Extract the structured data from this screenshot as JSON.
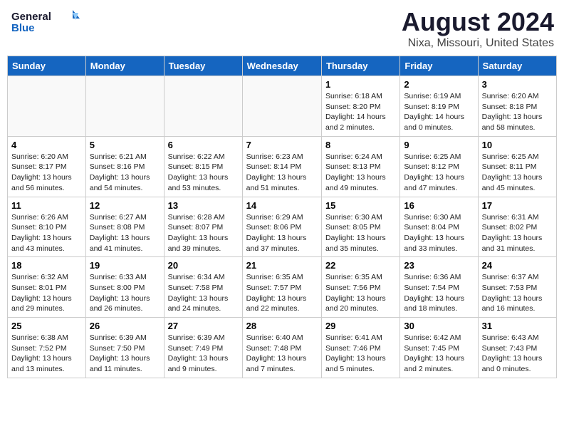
{
  "logo": {
    "line1": "General",
    "line2": "Blue",
    "tagline": ""
  },
  "title": "August 2024",
  "subtitle": "Nixa, Missouri, United States",
  "days_of_week": [
    "Sunday",
    "Monday",
    "Tuesday",
    "Wednesday",
    "Thursday",
    "Friday",
    "Saturday"
  ],
  "weeks": [
    [
      {
        "day": "",
        "info": ""
      },
      {
        "day": "",
        "info": ""
      },
      {
        "day": "",
        "info": ""
      },
      {
        "day": "",
        "info": ""
      },
      {
        "day": "1",
        "info": "Sunrise: 6:18 AM\nSunset: 8:20 PM\nDaylight: 14 hours\nand 2 minutes."
      },
      {
        "day": "2",
        "info": "Sunrise: 6:19 AM\nSunset: 8:19 PM\nDaylight: 14 hours\nand 0 minutes."
      },
      {
        "day": "3",
        "info": "Sunrise: 6:20 AM\nSunset: 8:18 PM\nDaylight: 13 hours\nand 58 minutes."
      }
    ],
    [
      {
        "day": "4",
        "info": "Sunrise: 6:20 AM\nSunset: 8:17 PM\nDaylight: 13 hours\nand 56 minutes."
      },
      {
        "day": "5",
        "info": "Sunrise: 6:21 AM\nSunset: 8:16 PM\nDaylight: 13 hours\nand 54 minutes."
      },
      {
        "day": "6",
        "info": "Sunrise: 6:22 AM\nSunset: 8:15 PM\nDaylight: 13 hours\nand 53 minutes."
      },
      {
        "day": "7",
        "info": "Sunrise: 6:23 AM\nSunset: 8:14 PM\nDaylight: 13 hours\nand 51 minutes."
      },
      {
        "day": "8",
        "info": "Sunrise: 6:24 AM\nSunset: 8:13 PM\nDaylight: 13 hours\nand 49 minutes."
      },
      {
        "day": "9",
        "info": "Sunrise: 6:25 AM\nSunset: 8:12 PM\nDaylight: 13 hours\nand 47 minutes."
      },
      {
        "day": "10",
        "info": "Sunrise: 6:25 AM\nSunset: 8:11 PM\nDaylight: 13 hours\nand 45 minutes."
      }
    ],
    [
      {
        "day": "11",
        "info": "Sunrise: 6:26 AM\nSunset: 8:10 PM\nDaylight: 13 hours\nand 43 minutes."
      },
      {
        "day": "12",
        "info": "Sunrise: 6:27 AM\nSunset: 8:08 PM\nDaylight: 13 hours\nand 41 minutes."
      },
      {
        "day": "13",
        "info": "Sunrise: 6:28 AM\nSunset: 8:07 PM\nDaylight: 13 hours\nand 39 minutes."
      },
      {
        "day": "14",
        "info": "Sunrise: 6:29 AM\nSunset: 8:06 PM\nDaylight: 13 hours\nand 37 minutes."
      },
      {
        "day": "15",
        "info": "Sunrise: 6:30 AM\nSunset: 8:05 PM\nDaylight: 13 hours\nand 35 minutes."
      },
      {
        "day": "16",
        "info": "Sunrise: 6:30 AM\nSunset: 8:04 PM\nDaylight: 13 hours\nand 33 minutes."
      },
      {
        "day": "17",
        "info": "Sunrise: 6:31 AM\nSunset: 8:02 PM\nDaylight: 13 hours\nand 31 minutes."
      }
    ],
    [
      {
        "day": "18",
        "info": "Sunrise: 6:32 AM\nSunset: 8:01 PM\nDaylight: 13 hours\nand 29 minutes."
      },
      {
        "day": "19",
        "info": "Sunrise: 6:33 AM\nSunset: 8:00 PM\nDaylight: 13 hours\nand 26 minutes."
      },
      {
        "day": "20",
        "info": "Sunrise: 6:34 AM\nSunset: 7:58 PM\nDaylight: 13 hours\nand 24 minutes."
      },
      {
        "day": "21",
        "info": "Sunrise: 6:35 AM\nSunset: 7:57 PM\nDaylight: 13 hours\nand 22 minutes."
      },
      {
        "day": "22",
        "info": "Sunrise: 6:35 AM\nSunset: 7:56 PM\nDaylight: 13 hours\nand 20 minutes."
      },
      {
        "day": "23",
        "info": "Sunrise: 6:36 AM\nSunset: 7:54 PM\nDaylight: 13 hours\nand 18 minutes."
      },
      {
        "day": "24",
        "info": "Sunrise: 6:37 AM\nSunset: 7:53 PM\nDaylight: 13 hours\nand 16 minutes."
      }
    ],
    [
      {
        "day": "25",
        "info": "Sunrise: 6:38 AM\nSunset: 7:52 PM\nDaylight: 13 hours\nand 13 minutes."
      },
      {
        "day": "26",
        "info": "Sunrise: 6:39 AM\nSunset: 7:50 PM\nDaylight: 13 hours\nand 11 minutes."
      },
      {
        "day": "27",
        "info": "Sunrise: 6:39 AM\nSunset: 7:49 PM\nDaylight: 13 hours\nand 9 minutes."
      },
      {
        "day": "28",
        "info": "Sunrise: 6:40 AM\nSunset: 7:48 PM\nDaylight: 13 hours\nand 7 minutes."
      },
      {
        "day": "29",
        "info": "Sunrise: 6:41 AM\nSunset: 7:46 PM\nDaylight: 13 hours\nand 5 minutes."
      },
      {
        "day": "30",
        "info": "Sunrise: 6:42 AM\nSunset: 7:45 PM\nDaylight: 13 hours\nand 2 minutes."
      },
      {
        "day": "31",
        "info": "Sunrise: 6:43 AM\nSunset: 7:43 PM\nDaylight: 13 hours\nand 0 minutes."
      }
    ]
  ]
}
